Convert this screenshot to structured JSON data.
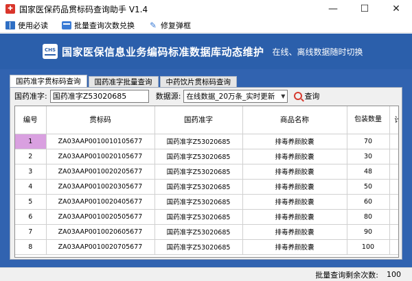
{
  "window": {
    "title": "国家医保药品贯标码查询助手 V1.4",
    "controls": {
      "minimize": "—",
      "maximize": "☐",
      "close": "✕"
    }
  },
  "menu": {
    "items": [
      {
        "label": "使用必读",
        "icon": "book-icon"
      },
      {
        "label": "批量查询次数兑换",
        "icon": "card-icon"
      },
      {
        "label": "修复弹框",
        "icon": "wrench-icon"
      }
    ]
  },
  "banner": {
    "logo_text": "CHS",
    "title": "国家医保信息业务编码标准数据库动态维护",
    "subtitle": "在线、离线数据随时切换"
  },
  "tabs": [
    {
      "label": "国药准字贯标码查询",
      "active": true
    },
    {
      "label": "国药准字批量查询",
      "active": false
    },
    {
      "label": "中药饮片贯标码查询",
      "active": false
    }
  ],
  "search": {
    "label": "国药准字:",
    "value": "国药准字Z53020685",
    "source_label": "数据源:",
    "source_value": "在线数据_20万条_实时更新",
    "query_label": "查询"
  },
  "table": {
    "headers": [
      "编号",
      "贯标码",
      "国药准字",
      "商品名称",
      "包装数量",
      "计"
    ],
    "rows": [
      [
        "1",
        "ZA03AAP0010010105677",
        "国药准字Z53020685",
        "排毒养颜胶囊",
        "70"
      ],
      [
        "2",
        "ZA03AAP0010020105677",
        "国药准字Z53020685",
        "排毒养颜胶囊",
        "30"
      ],
      [
        "3",
        "ZA03AAP0010020205677",
        "国药准字Z53020685",
        "排毒养颜胶囊",
        "48"
      ],
      [
        "4",
        "ZA03AAP0010020305677",
        "国药准字Z53020685",
        "排毒养颜胶囊",
        "50"
      ],
      [
        "5",
        "ZA03AAP0010020405677",
        "国药准字Z53020685",
        "排毒养颜胶囊",
        "60"
      ],
      [
        "6",
        "ZA03AAP0010020505677",
        "国药准字Z53020685",
        "排毒养颜胶囊",
        "80"
      ],
      [
        "7",
        "ZA03AAP0010020605677",
        "国药准字Z53020685",
        "排毒养颜胶囊",
        "90"
      ],
      [
        "8",
        "ZA03AAP0010020705677",
        "国药准字Z53020685",
        "排毒养颜胶囊",
        "100"
      ]
    ]
  },
  "status": {
    "label": "批量查询剩余次数:",
    "value": "100"
  },
  "colors": {
    "banner_bg": "#2b5fab",
    "content_bg": "#3163b0",
    "selected_cell": "#d9a0e0"
  }
}
